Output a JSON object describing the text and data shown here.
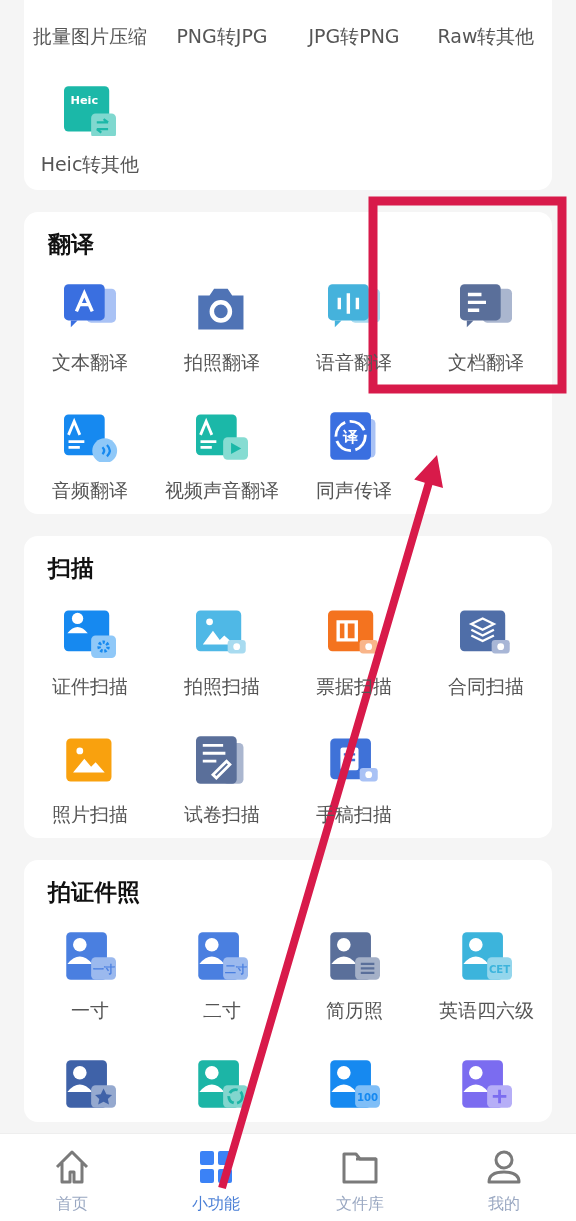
{
  "sections": [
    {
      "items": [
        {
          "label": "批量图片压缩"
        },
        {
          "label": "PNG转JPG"
        },
        {
          "label": "JPG转PNG"
        },
        {
          "label": "Raw转其他"
        },
        {
          "label": "Heic转其他",
          "kind": "heic",
          "icon_text": "Heic"
        }
      ]
    },
    {
      "title": "翻译",
      "items": [
        {
          "label": "文本翻译",
          "kind": "text"
        },
        {
          "label": "拍照翻译",
          "kind": "camera"
        },
        {
          "label": "语音翻译",
          "kind": "voice"
        },
        {
          "label": "文档翻译",
          "kind": "doc"
        },
        {
          "label": "音频翻译",
          "kind": "audio"
        },
        {
          "label": "视频声音翻译",
          "kind": "video"
        },
        {
          "label": "同声传译",
          "kind": "simul",
          "icon_text": "译"
        }
      ]
    },
    {
      "title": "扫描",
      "items": [
        {
          "label": "证件扫描",
          "kind": "idcard"
        },
        {
          "label": "拍照扫描",
          "kind": "photoscan"
        },
        {
          "label": "票据扫描",
          "kind": "receipt"
        },
        {
          "label": "合同扫描",
          "kind": "contract"
        },
        {
          "label": "照片扫描",
          "kind": "picture"
        },
        {
          "label": "试卷扫描",
          "kind": "exam"
        },
        {
          "label": "手稿扫描",
          "kind": "manuscript"
        }
      ]
    },
    {
      "title": "拍证件照",
      "items": [
        {
          "label": "一寸",
          "kind": "portrait",
          "color": "#4a7fe0",
          "icon_text": "一寸"
        },
        {
          "label": "二寸",
          "kind": "portrait",
          "color": "#4a7fe0",
          "icon_text": "二寸"
        },
        {
          "label": "简历照",
          "kind": "portraitlines",
          "color": "#5a6f9a"
        },
        {
          "label": "英语四六级",
          "kind": "portrait",
          "color": "#3cb4dc",
          "icon_text": "CET"
        },
        {
          "kind": "portraitstar",
          "color": "#3f62a8"
        },
        {
          "kind": "portraitswirl",
          "color": "#1cb5a6"
        },
        {
          "kind": "portrait",
          "color": "#1689f0",
          "icon_text": "100"
        },
        {
          "kind": "portraitplus",
          "color": "#7b6cf0"
        }
      ]
    }
  ],
  "nav": [
    {
      "label": "首页",
      "kind": "home",
      "selected": false
    },
    {
      "label": "小功能",
      "kind": "grid",
      "selected": true
    },
    {
      "label": "文件库",
      "kind": "folder",
      "selected": false
    },
    {
      "label": "我的",
      "kind": "person",
      "selected": false
    }
  ],
  "annotations": {
    "frame": true,
    "arrow": true
  }
}
